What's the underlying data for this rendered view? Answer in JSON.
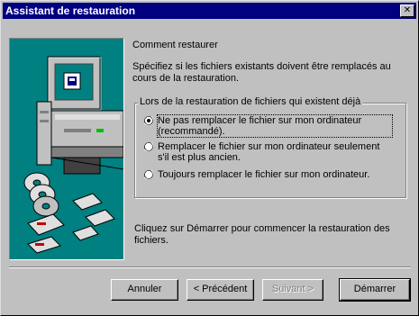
{
  "window": {
    "title": "Assistant de restauration",
    "close_glyph": "✕"
  },
  "content": {
    "heading": "Comment restaurer",
    "description": "Spécifiez si les fichiers existants doivent être remplacés au cours de la restauration.",
    "group_label": "Lors de la restauration de fichiers qui existent déjà",
    "options": [
      {
        "label": "Ne pas remplacer le fichier sur mon ordinateur (recommandé).",
        "selected": true
      },
      {
        "label": "Remplacer le fichier sur mon ordinateur seulement s'il est plus ancien.",
        "selected": false
      },
      {
        "label": "Toujours remplacer le fichier sur mon ordinateur.",
        "selected": false
      }
    ],
    "footer": "Cliquez sur Démarrer pour commencer la restauration des fichiers."
  },
  "buttons": {
    "cancel": "Annuler",
    "back": "< Précédent",
    "next": "Suivant >",
    "start": "Démarrer"
  },
  "colors": {
    "titlebar": "#000080",
    "face": "#c0c0c0",
    "illustration_bg": "#008080"
  },
  "icons": {
    "illustration": "computer-with-discs-and-tapes-icon"
  }
}
